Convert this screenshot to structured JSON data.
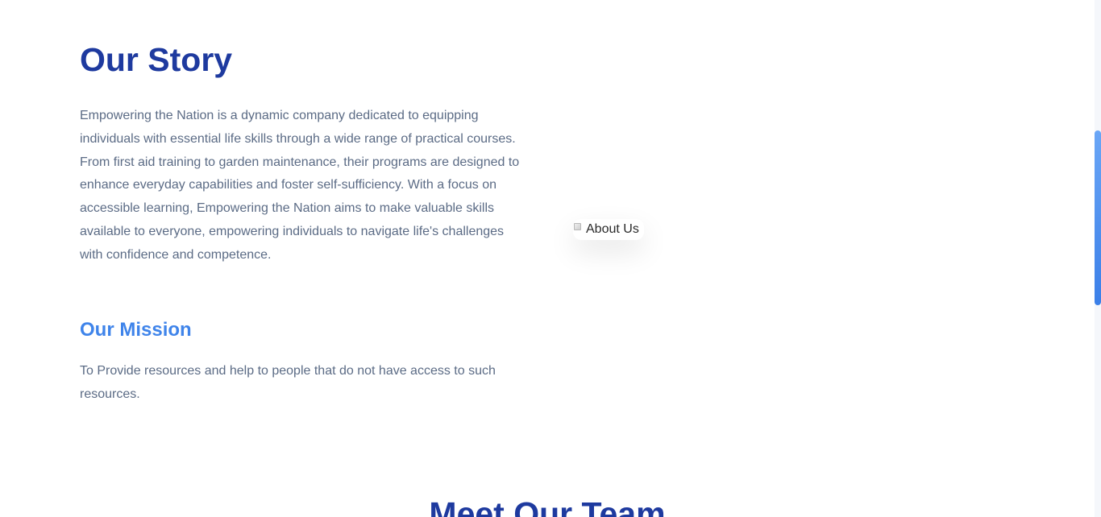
{
  "story": {
    "title": "Our Story",
    "paragraph": "Empowering the Nation is a dynamic company dedicated to equipping individuals with essential life skills through a wide range of practical courses. From first aid training to garden maintenance, their programs are designed to enhance everyday capabilities and foster self-sufficiency. With a focus on accessible learning, Empowering the Nation aims to make valuable skills available to everyone, empowering individuals to navigate life's challenges with confidence and competence."
  },
  "mission": {
    "title": "Our Mission",
    "paragraph": "To Provide resources and help to people that do not have access to such resources."
  },
  "about_image": {
    "alt": "About Us",
    "icon": "broken-image-icon"
  },
  "team": {
    "title": "Meet Our Team"
  },
  "colors": {
    "heading": "#1e3a9f",
    "accent": "#3f84ea",
    "body_text": "#5b6b85"
  }
}
